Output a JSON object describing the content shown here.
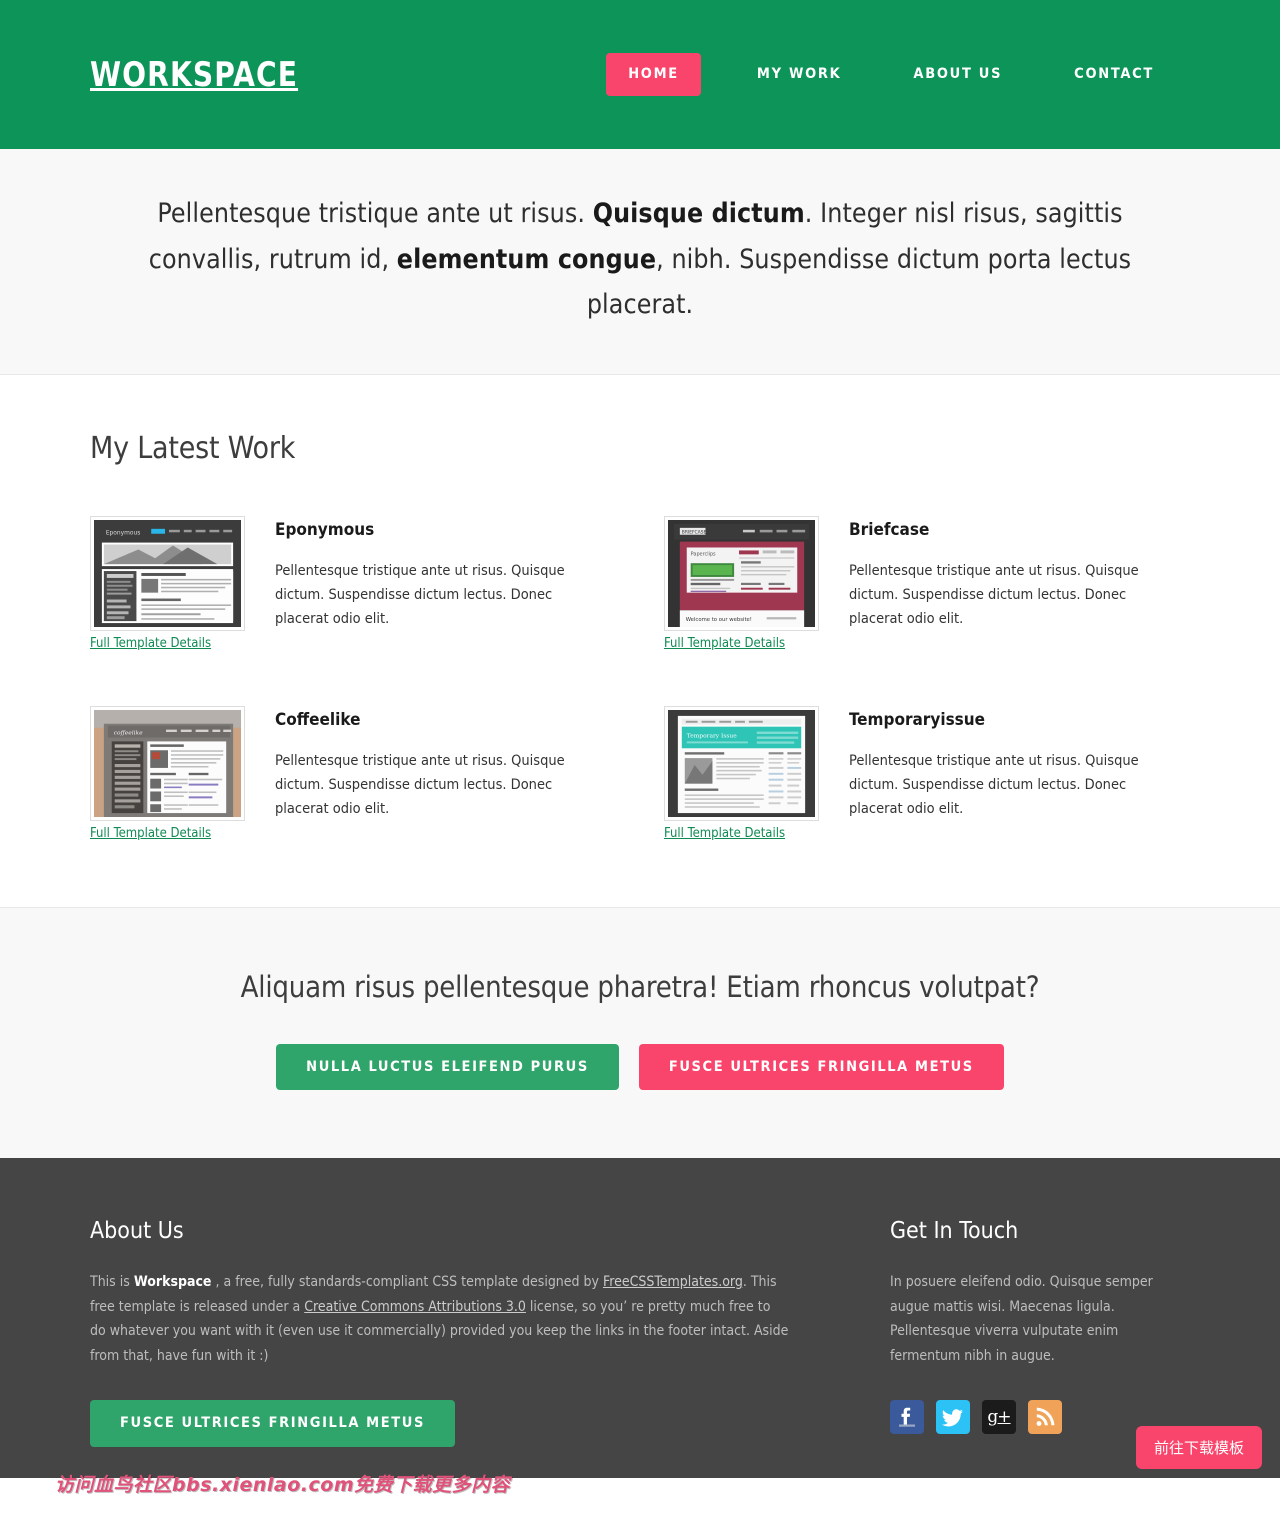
{
  "header": {
    "logo": "WORKSPACE",
    "nav": [
      {
        "label": "HOME",
        "active": true
      },
      {
        "label": "MY WORK",
        "active": false
      },
      {
        "label": "ABOUT US",
        "active": false
      },
      {
        "label": "CONTACT",
        "active": false
      }
    ],
    "bg_color": "#0d9459",
    "active_color": "#f9456b"
  },
  "hero": {
    "part1": "Pellentesque tristique ante ut risus. ",
    "bold1": "Quisque dictum",
    "part2": ". Integer nisl risus, sagittis convallis, rutrum id, ",
    "bold2": "elementum congue",
    "part3": ", nibh. Suspendisse dictum porta lectus placerat."
  },
  "work": {
    "title": "My Latest Work",
    "link_label": "Full Template Details",
    "items": [
      {
        "name": "Eponymous",
        "desc": "Pellentesque tristique ante ut risus. Quisque dictum. Suspendisse dictum lectus. Donec placerat odio elit.",
        "link": "Full Template Details",
        "thumb_label": "Eponymous"
      },
      {
        "name": "Briefcase",
        "desc": "Pellentesque tristique ante ut risus. Quisque dictum. Suspendisse dictum lectus. Donec placerat odio elit.",
        "link": "Full Template Details",
        "thumb_label": "Briefcase"
      },
      {
        "name": "Coffeelike",
        "desc": "Pellentesque tristique ante ut risus. Quisque dictum. Suspendisse dictum lectus. Donec placerat odio elit.",
        "link": "Full Template Details",
        "thumb_label": "coffeelike"
      },
      {
        "name": "Temporaryissue",
        "desc": "Pellentesque tristique ante ut risus. Quisque dictum. Suspendisse dictum lectus. Donec placerat odio elit.",
        "link": "Full Template Details",
        "thumb_label": "Temporary Issue"
      }
    ]
  },
  "cta": {
    "title": "Aliquam risus pellentesque pharetra! Etiam rhoncus volutpat?",
    "button_green": "NULLA LUCTUS ELEIFEND PURUS",
    "button_pink": "FUSCE ULTRICES FRINGILLA METUS",
    "green_color": "#30a56b",
    "pink_color": "#f9456b"
  },
  "footer": {
    "about_heading": "About Us",
    "about_p1": "This is ",
    "about_brand": "Workspace",
    "about_p2": " , a free, fully standards-compliant CSS template designed by ",
    "about_link1": "FreeCSSTemplates.org",
    "about_p3": ". This free template is released under a ",
    "about_link2": "Creative Commons Attributions 3.0",
    "about_p4": " license, so you’ re pretty much free to do whatever you want with it (even use it commercially) provided you keep the links in the footer intact. Aside from that, have fun with it :)",
    "about_button": "FUSCE ULTRICES FRINGILLA METUS",
    "touch_heading": "Get In Touch",
    "touch_text": "In posuere eleifend odio. Quisque semper augue mattis wisi. Maecenas ligula. Pellentesque viverra vulputate enim fermentum nibh in augue.",
    "social": [
      {
        "name": "facebook",
        "glyph": "f"
      },
      {
        "name": "twitter",
        "glyph": "🐦"
      },
      {
        "name": "google-plus",
        "glyph": "g+"
      },
      {
        "name": "rss",
        "glyph": "◖"
      }
    ],
    "bg_color": "#454545"
  },
  "overlay": {
    "watermark": "访问血鸟社区bbs.xienlao.com免费下载更多内容",
    "download_button": "前往下载模板"
  }
}
